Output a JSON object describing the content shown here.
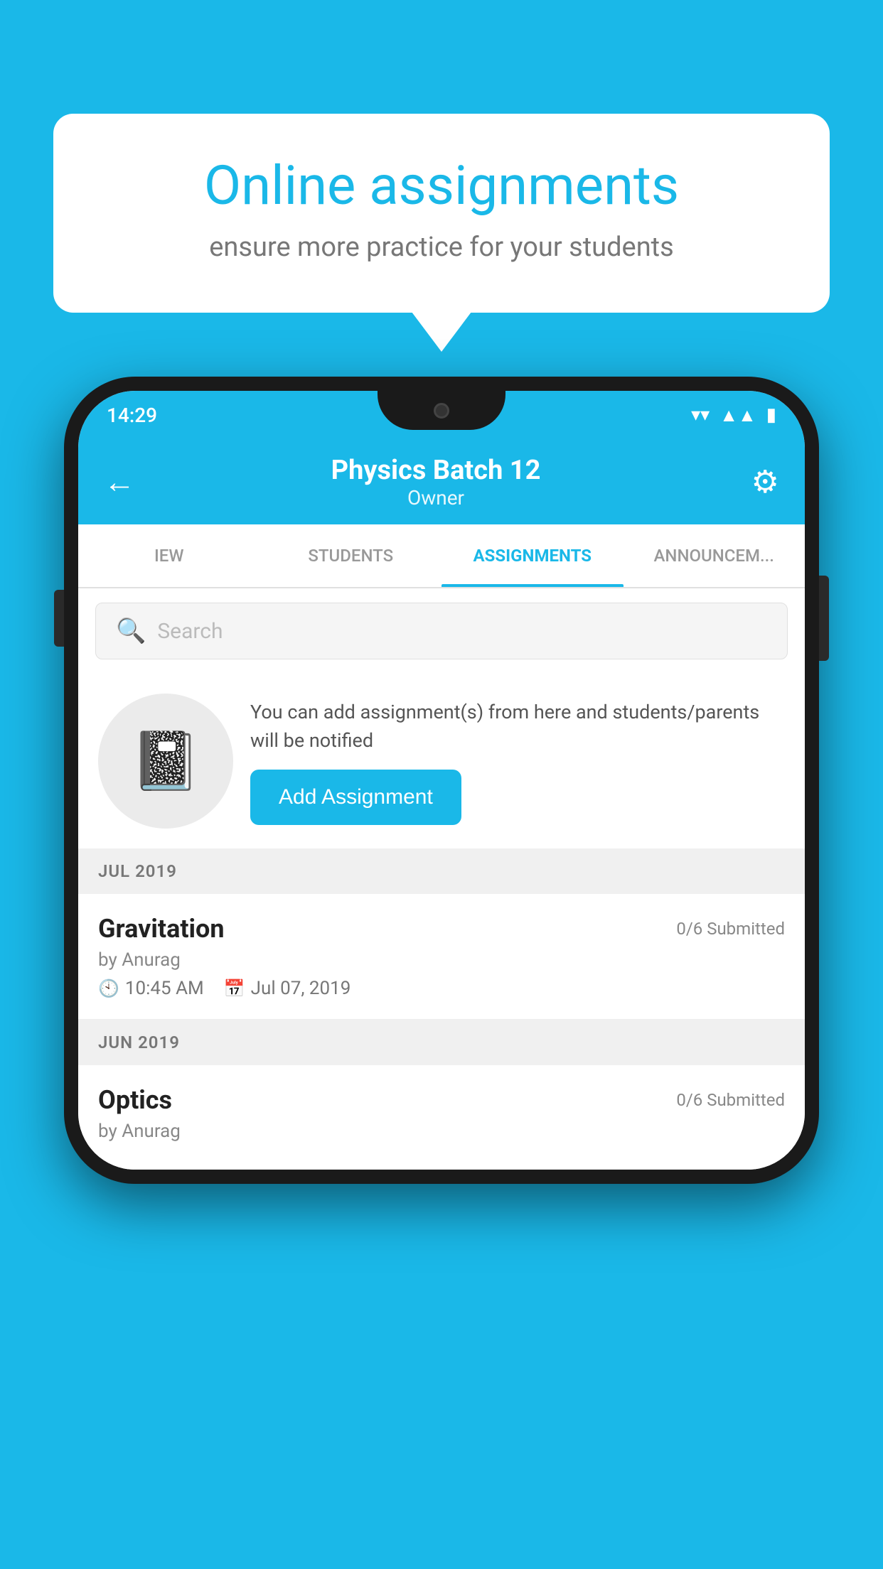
{
  "background": {
    "color": "#1ab8e8"
  },
  "speech_bubble": {
    "title": "Online assignments",
    "subtitle": "ensure more practice for your students"
  },
  "status_bar": {
    "time": "14:29",
    "wifi_icon": "▼",
    "signal_icon": "◀",
    "battery_icon": "▮"
  },
  "app_bar": {
    "title": "Physics Batch 12",
    "subtitle": "Owner",
    "back_label": "←",
    "settings_label": "⚙"
  },
  "tabs": [
    {
      "label": "IEW",
      "active": false
    },
    {
      "label": "STUDENTS",
      "active": false
    },
    {
      "label": "ASSIGNMENTS",
      "active": true
    },
    {
      "label": "ANNOUNCEM...",
      "active": false
    }
  ],
  "search": {
    "placeholder": "Search"
  },
  "promo": {
    "description": "You can add assignment(s) from here and students/parents will be notified",
    "button_label": "Add Assignment"
  },
  "sections": [
    {
      "header": "JUL 2019",
      "items": [
        {
          "title": "Gravitation",
          "submitted": "0/6 Submitted",
          "by": "by Anurag",
          "time": "10:45 AM",
          "date": "Jul 07, 2019"
        }
      ]
    },
    {
      "header": "JUN 2019",
      "items": [
        {
          "title": "Optics",
          "submitted": "0/6 Submitted",
          "by": "by Anurag",
          "time": "",
          "date": ""
        }
      ]
    }
  ]
}
